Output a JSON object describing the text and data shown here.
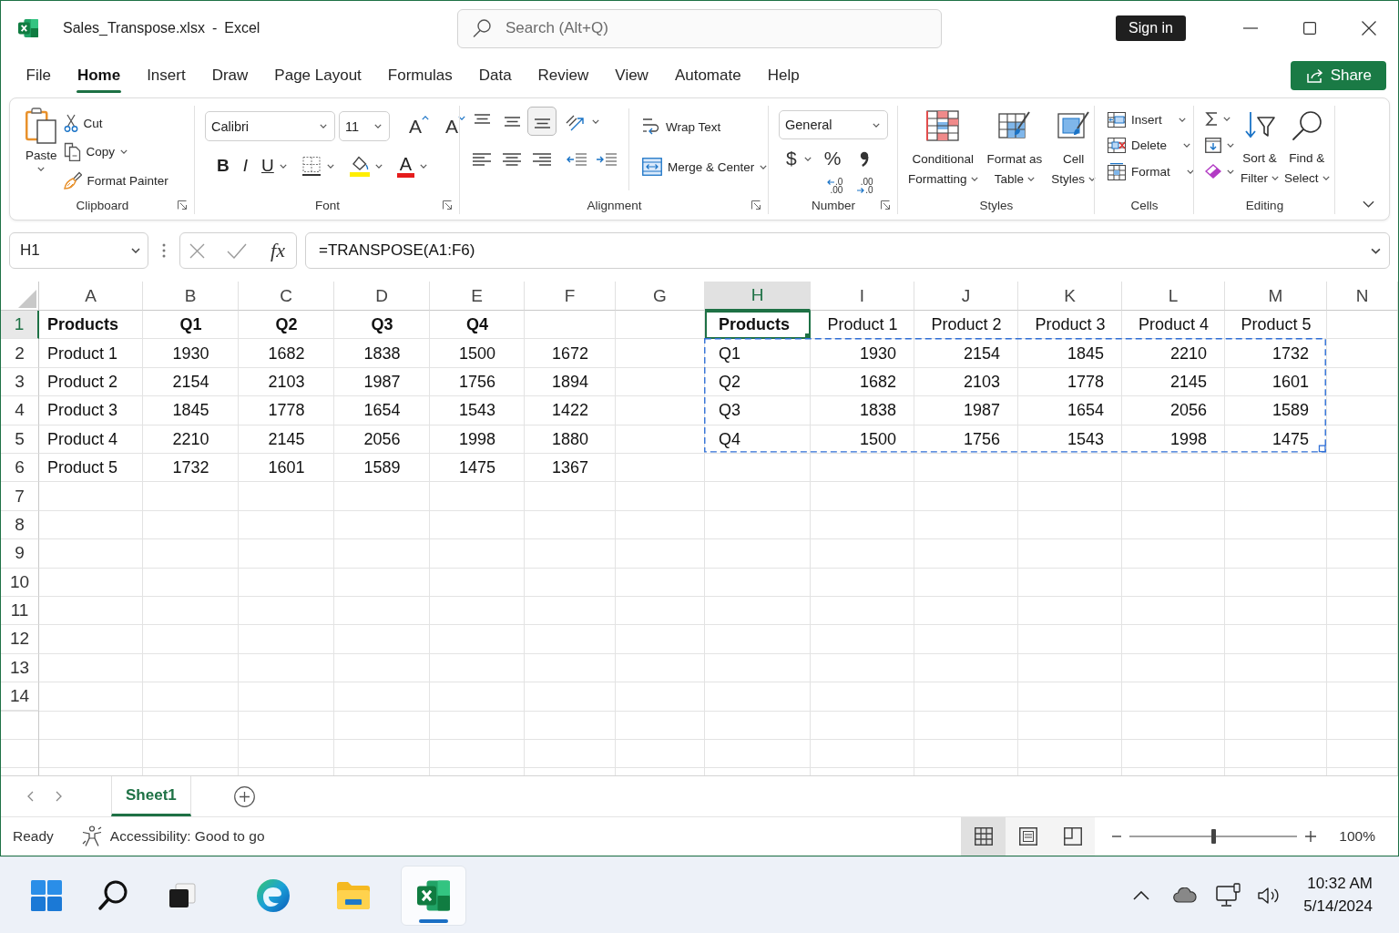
{
  "window": {
    "file_name": "Sales_Transpose.xlsx",
    "separator": "-",
    "app_name": "Excel"
  },
  "search": {
    "placeholder": "Search (Alt+Q)"
  },
  "sign_in": "Sign in",
  "menu_tabs": [
    {
      "label": "File",
      "selected": false
    },
    {
      "label": "Home",
      "selected": true
    },
    {
      "label": "Insert",
      "selected": false
    },
    {
      "label": "Draw",
      "selected": false
    },
    {
      "label": "Page Layout",
      "selected": false
    },
    {
      "label": "Formulas",
      "selected": false
    },
    {
      "label": "Data",
      "selected": false
    },
    {
      "label": "Review",
      "selected": false
    },
    {
      "label": "View",
      "selected": false
    },
    {
      "label": "Automate",
      "selected": false
    },
    {
      "label": "Help",
      "selected": false
    }
  ],
  "share": "Share",
  "ribbon": {
    "clipboard": {
      "label": "Clipboard",
      "paste": "Paste",
      "cut": "Cut",
      "copy": "Copy",
      "format_painter": "Format Painter"
    },
    "font": {
      "label": "Font",
      "font_name": "Calibri",
      "font_size": "11",
      "grow": "A",
      "shrink": "A",
      "styles": [
        {
          "kind": "bold",
          "label": "B"
        },
        {
          "kind": "italic",
          "label": "I"
        },
        {
          "kind": "underline",
          "label": "U"
        }
      ],
      "font_color": "A"
    },
    "alignment": {
      "label": "Alignment",
      "vertical": [
        {
          "kind": "top",
          "selected": false
        },
        {
          "kind": "middle",
          "selected": false
        },
        {
          "kind": "bottom",
          "selected": true
        }
      ],
      "horizontal": [
        {
          "kind": "left",
          "selected": false
        },
        {
          "kind": "center",
          "selected": false
        },
        {
          "kind": "right",
          "selected": false
        }
      ],
      "wrap_text": "Wrap Text",
      "merge_center": "Merge & Center"
    },
    "number": {
      "label": "Number",
      "format": "General",
      "currency": "$",
      "percent": "%",
      "decimals": [
        {
          "kind": "increase",
          "lines": [
            ".0",
            ".00"
          ]
        },
        {
          "kind": "decrease",
          "lines": [
            ".00",
            ".0"
          ]
        }
      ]
    },
    "styles": {
      "label": "Styles",
      "buttons": [
        {
          "kind": "conditional",
          "lines": [
            "Conditional",
            "Formatting"
          ]
        },
        {
          "kind": "table",
          "lines": [
            "Format as",
            "Table"
          ]
        },
        {
          "kind": "cell",
          "lines": [
            "Cell",
            "Styles"
          ]
        }
      ]
    },
    "cells": {
      "label": "Cells",
      "buttons": [
        {
          "kind": "insert",
          "label": "Insert"
        },
        {
          "kind": "delete",
          "label": "Delete"
        },
        {
          "kind": "format",
          "label": "Format"
        }
      ]
    },
    "editing": {
      "label": "Editing",
      "buttons": [
        {
          "kind": "sort",
          "lines": [
            "Sort &",
            "Filter"
          ]
        },
        {
          "kind": "find",
          "lines": [
            "Find &",
            "Select"
          ]
        }
      ]
    }
  },
  "formula_bar": {
    "name_box": "H1",
    "function_button": "fx",
    "formula": "=TRANSPOSE(A1:F6)"
  },
  "sheet": {
    "columns": [
      {
        "label": "A",
        "selected": false
      },
      {
        "label": "B",
        "selected": false
      },
      {
        "label": "C",
        "selected": false
      },
      {
        "label": "D",
        "selected": false
      },
      {
        "label": "E",
        "selected": false
      },
      {
        "label": "F",
        "selected": false
      },
      {
        "label": "G",
        "selected": false
      },
      {
        "label": "H",
        "selected": true
      },
      {
        "label": "I",
        "selected": false
      },
      {
        "label": "J",
        "selected": false
      },
      {
        "label": "K",
        "selected": false
      },
      {
        "label": "L",
        "selected": false
      },
      {
        "label": "M",
        "selected": false
      },
      {
        "label": "N",
        "selected": false
      }
    ],
    "rows": [
      {
        "label": "1",
        "selected": true
      },
      {
        "label": "2",
        "selected": false
      },
      {
        "label": "3",
        "selected": false
      },
      {
        "label": "4",
        "selected": false
      },
      {
        "label": "5",
        "selected": false
      },
      {
        "label": "6",
        "selected": false
      },
      {
        "label": "7",
        "selected": false
      },
      {
        "label": "8",
        "selected": false
      },
      {
        "label": "9",
        "selected": false
      },
      {
        "label": "10",
        "selected": false
      },
      {
        "label": "11",
        "selected": false
      },
      {
        "label": "12",
        "selected": false
      },
      {
        "label": "13",
        "selected": false
      },
      {
        "label": "14",
        "selected": false
      }
    ],
    "source_table": {
      "header": [
        "Products",
        "Q1",
        "Q2",
        "Q3",
        "Q4"
      ],
      "rows": [
        [
          "Product 1",
          "1930",
          "1682",
          "1838",
          "1500",
          "1672"
        ],
        [
          "Product 2",
          "2154",
          "2103",
          "1987",
          "1756",
          "1894"
        ],
        [
          "Product 3",
          "1845",
          "1778",
          "1654",
          "1543",
          "1422"
        ],
        [
          "Product 4",
          "2210",
          "2145",
          "2056",
          "1998",
          "1880"
        ],
        [
          "Product 5",
          "1732",
          "1601",
          "1589",
          "1475",
          "1367"
        ]
      ]
    },
    "transposed_table": {
      "header": [
        "Products",
        "Product 1",
        "Product 2",
        "Product 3",
        "Product 4",
        "Product 5"
      ],
      "rows": [
        [
          "Q1",
          "1930",
          "2154",
          "1845",
          "2210",
          "1732"
        ],
        [
          "Q2",
          "1682",
          "2103",
          "1778",
          "2145",
          "1601"
        ],
        [
          "Q3",
          "1838",
          "1987",
          "1654",
          "2056",
          "1589"
        ],
        [
          "Q4",
          "1500",
          "1756",
          "1543",
          "1998",
          "1475"
        ]
      ],
      "outlined": true
    }
  },
  "sheet_tabs": [
    {
      "label": "Sheet1",
      "selected": true
    }
  ],
  "status_bar": {
    "status": "Ready",
    "accessibility": "Accessibility: Good to go",
    "views": [
      {
        "kind": "normal",
        "selected": true
      },
      {
        "kind": "page_layout",
        "selected": false
      },
      {
        "kind": "page_break",
        "selected": false
      }
    ],
    "zoom": {
      "level": 0.5,
      "reading": "100%"
    }
  },
  "taskbar": {
    "apps": [
      {
        "kind": "start",
        "selected": false
      },
      {
        "kind": "search",
        "selected": false
      },
      {
        "kind": "task_view",
        "selected": false
      },
      {
        "kind": "browser",
        "selected": false
      },
      {
        "kind": "files",
        "selected": false
      },
      {
        "kind": "spreadsheet",
        "selected": true
      }
    ],
    "time": "10:32 AM",
    "date": "5/14/2024"
  }
}
